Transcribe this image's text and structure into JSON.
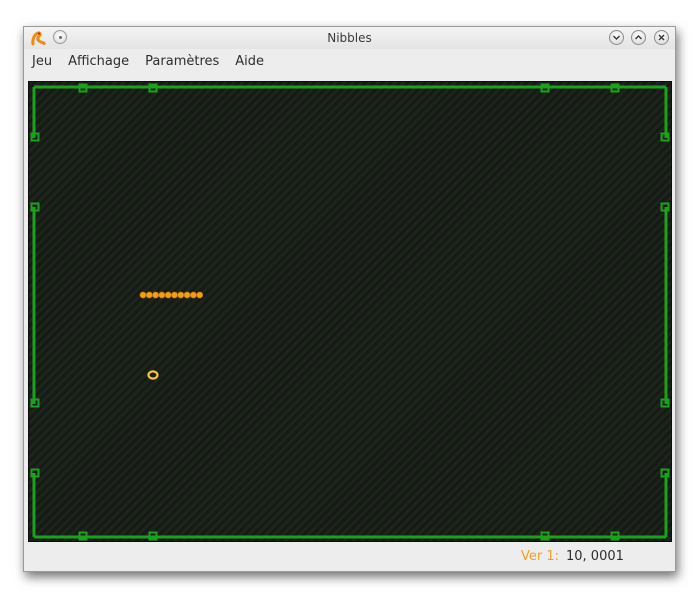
{
  "window": {
    "title": "Nibbles"
  },
  "titlebar": {
    "app_icon": "nibbles-app-icon",
    "window_menu_icon": "window-menu-icon",
    "buttons": [
      {
        "name": "minimize",
        "icon": "chevron-down-icon",
        "glyph": "⌄"
      },
      {
        "name": "maximize",
        "icon": "chevron-up-icon",
        "glyph": "⌃"
      },
      {
        "name": "close",
        "icon": "close-icon",
        "glyph": "✕"
      }
    ]
  },
  "menubar": {
    "items": [
      "Jeu",
      "Affichage",
      "Paramètres",
      "Aide"
    ]
  },
  "game": {
    "wall_color": "#1aa31a",
    "snake_color": "#f0a010",
    "bonus_color": "#f5c542",
    "snake_segment_count": 10,
    "bonus": "ring"
  },
  "status": {
    "player_label": "Ver 1:",
    "score": "10, 0001"
  }
}
